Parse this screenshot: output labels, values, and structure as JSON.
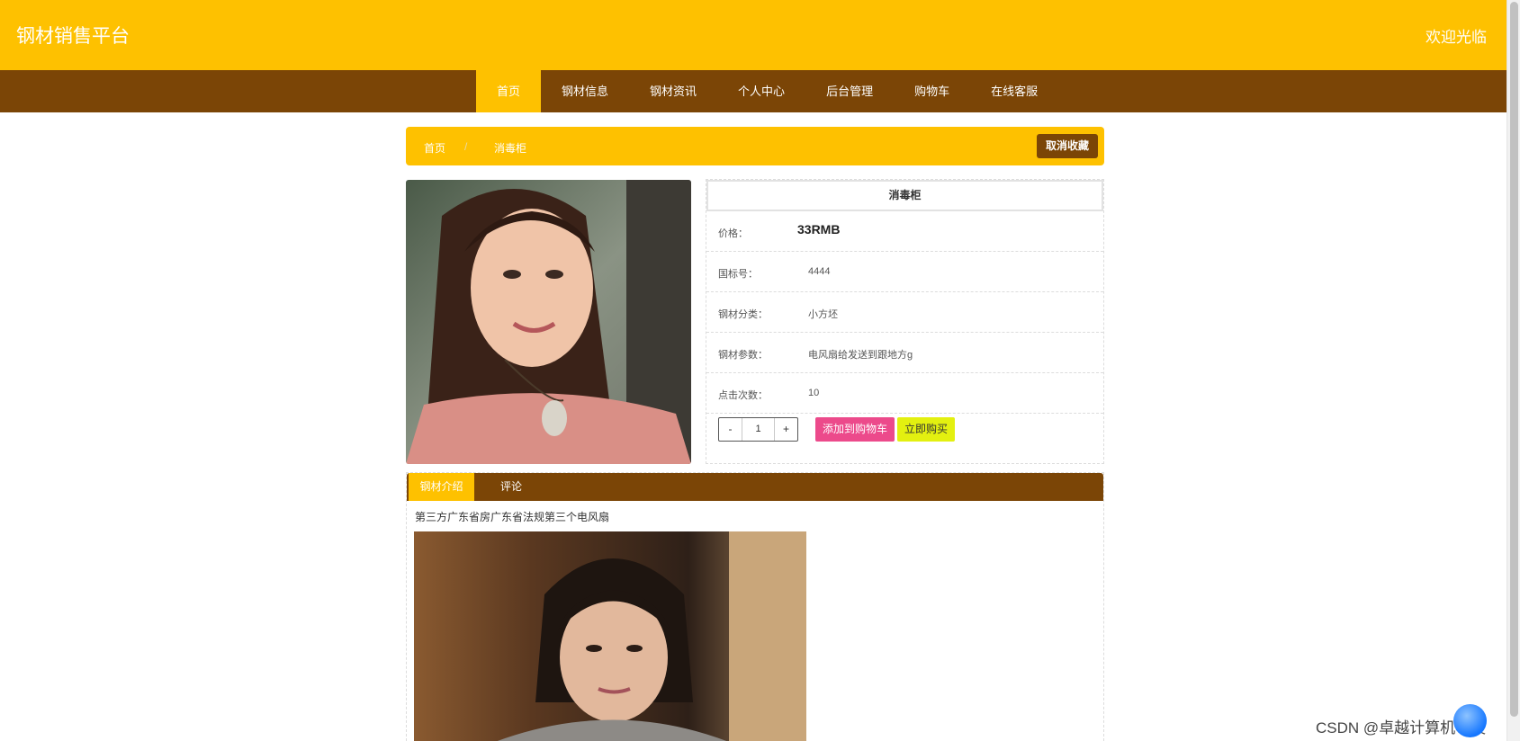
{
  "header": {
    "brand": "钢材销售平台",
    "welcome": "欢迎光临"
  },
  "nav": {
    "items": [
      {
        "label": "首页",
        "active": true
      },
      {
        "label": "钢材信息",
        "active": false
      },
      {
        "label": "钢材资讯",
        "active": false
      },
      {
        "label": "个人中心",
        "active": false
      },
      {
        "label": "后台管理",
        "active": false
      },
      {
        "label": "购物车",
        "active": false
      },
      {
        "label": "在线客服",
        "active": false
      }
    ]
  },
  "breadcrumb": {
    "home": "首页",
    "separator": "/",
    "current": "消毒柜",
    "unfavorite_label": "取消收藏"
  },
  "product": {
    "title": "消毒柜",
    "price_label": "价格：",
    "price": "33RMB",
    "code_label": "国标号：",
    "code": "4444",
    "category_label": "钢材分类：",
    "category": "小方坯",
    "params_label": "钢材参数：",
    "params": "电风扇给发送到跟地方g",
    "clicks_label": "点击次数：",
    "clicks": "10"
  },
  "purchase": {
    "minus": "-",
    "quantity": "1",
    "plus": "+",
    "add_to_cart": "添加到购物车",
    "buy_now": "立即购买"
  },
  "tabs": {
    "intro": "钢材介绍",
    "comment": "评论"
  },
  "intro": {
    "text": "第三方广东省房广东省法规第三个电风扇"
  },
  "watermark": "CSDN @卓越计算机毕设",
  "colors": {
    "primary": "#fec100",
    "secondary": "#7b4506",
    "cart": "#ec4a8b",
    "buy": "#e3f010"
  }
}
